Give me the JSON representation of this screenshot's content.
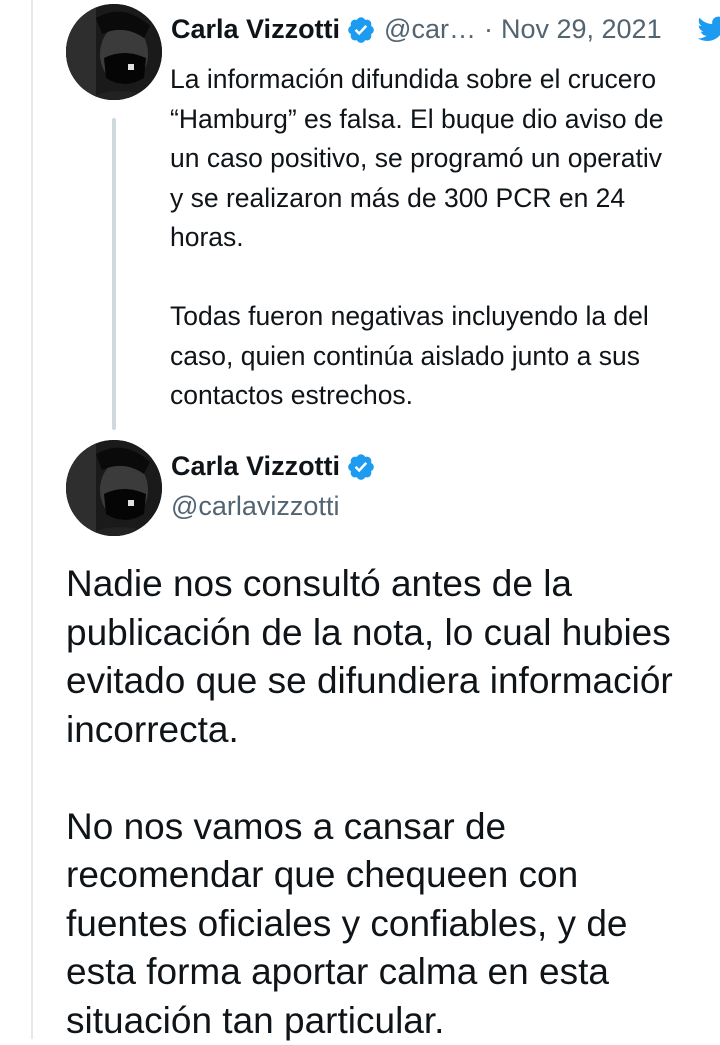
{
  "reply_tweet": {
    "author_name": "Carla Vizzotti",
    "handle": "@car…",
    "separator": "·",
    "date": "Nov 29, 2021",
    "text_lines_p1": [
      "La información difundida sobre el crucero",
      "“Hamburg” es falsa. El buque dio aviso de",
      "un caso positivo, se programó un operativ",
      "y se realizaron más de 300 PCR en 24",
      "horas."
    ],
    "text_lines_p2": [
      "Todas fueron negativas incluyendo la del",
      "caso, quien continúa aislado junto a sus",
      "contactos estrechos."
    ]
  },
  "main_tweet": {
    "author_name": "Carla Vizzotti",
    "handle": "@carlavizzotti",
    "text_lines_p1": [
      "Nadie nos consultó antes de la",
      "publicación de la nota, lo cual hubies",
      "evitado que se difundiera informaciór",
      "incorrecta."
    ],
    "text_lines_p2": [
      "No nos vamos a cansar de",
      "recomendar que chequeen con",
      "fuentes oficiales y confiables, y de",
      "esta forma aportar calma en esta",
      "situación tan particular."
    ]
  },
  "icons": {
    "verified": "verified-badge-icon",
    "platform": "twitter-bird-icon"
  },
  "colors": {
    "verified_blue": "#1d9bf0",
    "muted_text": "#536471",
    "thread_line": "#cfd9de"
  }
}
